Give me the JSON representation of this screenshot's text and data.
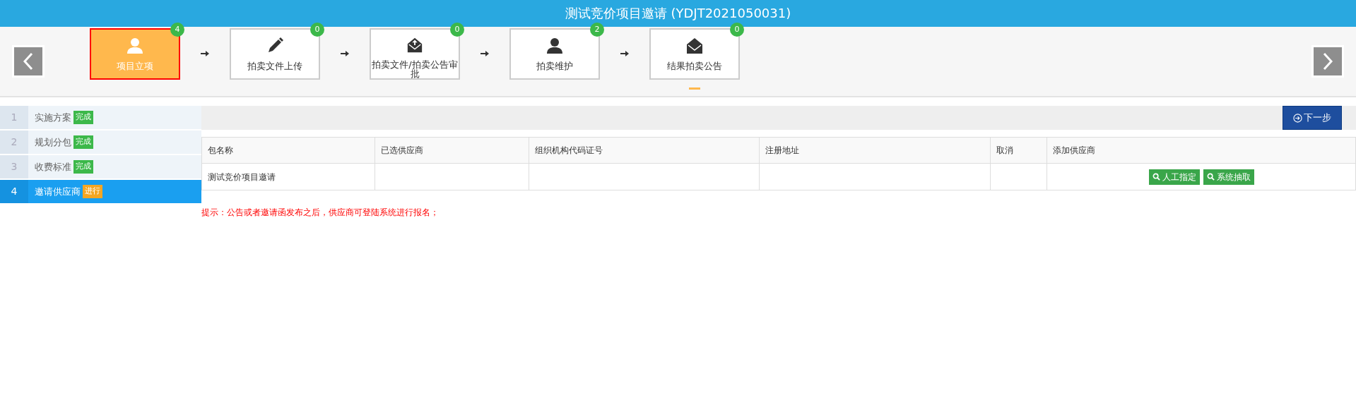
{
  "header": {
    "title": "测试竞价项目邀请 (YDJT2021050031)"
  },
  "steps": [
    {
      "label": "项目立项",
      "count": "4",
      "kind": "user",
      "selected": true,
      "marked": false
    },
    {
      "label": "拍卖文件上传",
      "count": "0",
      "kind": "pencil",
      "selected": false,
      "marked": false
    },
    {
      "label": "拍卖文件/拍卖公告审批",
      "count": "0",
      "kind": "mail-upload",
      "selected": false,
      "marked": false
    },
    {
      "label": "拍卖维护",
      "count": "2",
      "kind": "user",
      "selected": false,
      "marked": false
    },
    {
      "label": "结果拍卖公告",
      "count": "0",
      "kind": "mail",
      "selected": false,
      "marked": true
    }
  ],
  "sidebar": {
    "items": [
      {
        "number": "1",
        "label": "实施方案",
        "status": "完成",
        "kind": "done",
        "selected": false
      },
      {
        "number": "2",
        "label": "规划分包",
        "status": "完成",
        "kind": "done",
        "selected": false
      },
      {
        "number": "3",
        "label": "收费标准",
        "status": "完成",
        "kind": "done",
        "selected": false
      },
      {
        "number": "4",
        "label": "邀请供应商",
        "status": "进行",
        "kind": "active",
        "selected": true
      }
    ]
  },
  "next_button": "下一步",
  "table": {
    "columns": [
      "包名称",
      "已选供应商",
      "组织机构代码证号",
      "注册地址",
      "取消",
      "添加供应商"
    ],
    "rows": [
      {
        "cells": [
          "测试竞价项目邀请",
          "",
          "",
          "",
          ""
        ],
        "actions": [
          "人工指定",
          "系统抽取"
        ]
      }
    ]
  },
  "hint": "提示：公告或者邀请函发布之后，供应商可登陆系统进行报名；"
}
